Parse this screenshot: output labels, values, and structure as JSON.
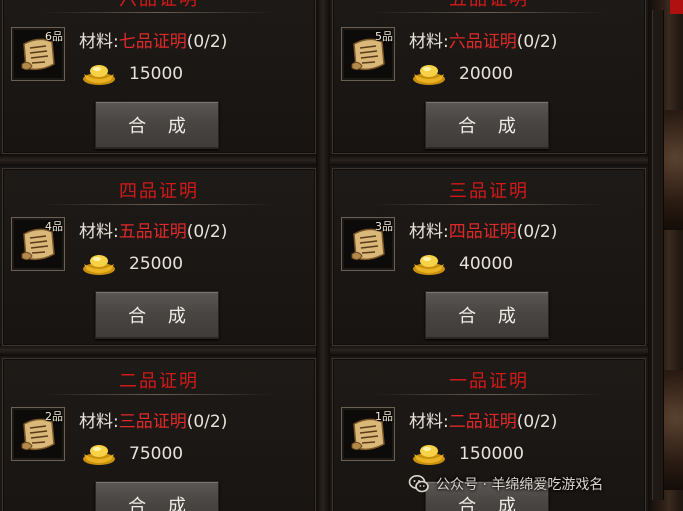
{
  "labels": {
    "material_prefix": "材料:",
    "craft_button": "合 成"
  },
  "colors": {
    "title_red": "#d21a1a",
    "material_red": "#e02a2a"
  },
  "cards": [
    {
      "title": "六品证明",
      "grade": "6品",
      "material": "七品证明",
      "progress": "(0/2)",
      "gold": "15000"
    },
    {
      "title": "五品证明",
      "grade": "5品",
      "material": "六品证明",
      "progress": "(0/2)",
      "gold": "20000"
    },
    {
      "title": "四品证明",
      "grade": "4品",
      "material": "五品证明",
      "progress": "(0/2)",
      "gold": "25000"
    },
    {
      "title": "三品证明",
      "grade": "3品",
      "material": "四品证明",
      "progress": "(0/2)",
      "gold": "40000"
    },
    {
      "title": "二品证明",
      "grade": "2品",
      "material": "三品证明",
      "progress": "(0/2)",
      "gold": "75000"
    },
    {
      "title": "一品证明",
      "grade": "1品",
      "material": "二品证明",
      "progress": "(0/2)",
      "gold": "150000"
    }
  ],
  "watermark": {
    "icon": "wechat-icon",
    "text": "公众号 · 羊绵绵爱吃游戏名"
  }
}
